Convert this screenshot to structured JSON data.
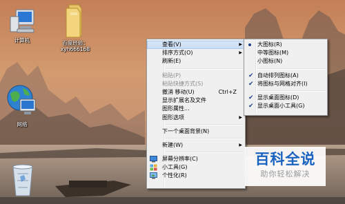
{
  "desktop": {
    "icons": [
      {
        "label": "计算机",
        "icon": "computer-icon"
      },
      {
        "label": "百度经验：",
        "label2": "xyh666168",
        "icon": "folder-icon"
      },
      {
        "label": "网络",
        "icon": "network-icon"
      },
      {
        "label": "",
        "icon": "recycle-bin-icon"
      }
    ]
  },
  "context_menu": {
    "items": [
      {
        "label": "查看(V)",
        "submenu": true,
        "highlighted": true
      },
      {
        "label": "排序方式(O)",
        "submenu": true
      },
      {
        "label": "刷新(E)"
      },
      {
        "label": "粘贴(P)",
        "disabled": true
      },
      {
        "label": "粘贴快捷方式(S)",
        "disabled": true
      },
      {
        "label": "撤消 移动(U)",
        "shortcut": "Ctrl+Z"
      },
      {
        "label": "显示扩展名及文件"
      },
      {
        "label": "图形属性..."
      },
      {
        "label": "图形选项",
        "submenu": true
      },
      {
        "label": "下一个桌面背景(N)"
      },
      {
        "label": "新建(W)",
        "submenu": true
      },
      {
        "label": "屏幕分辨率(C)",
        "icon": "display-settings-icon"
      },
      {
        "label": "小工具(G)",
        "icon": "gadgets-icon"
      },
      {
        "label": "个性化(R)",
        "icon": "personalize-icon"
      }
    ]
  },
  "view_submenu": {
    "items": [
      {
        "label": "大图标(R)",
        "selected": true
      },
      {
        "label": "中等图标(M)"
      },
      {
        "label": "小图标(N)"
      },
      {
        "label": "自动排列图标(A)",
        "checked": true
      },
      {
        "label": "将图标与网格对齐(I)",
        "checked": true
      },
      {
        "label": "显示桌面图标(D)",
        "checked": true
      },
      {
        "label": "显示桌面小工具(G)",
        "checked": true
      }
    ]
  },
  "watermark": {
    "title": "百科全说",
    "subtitle": "助你轻松解决"
  },
  "colors": {
    "menu_bg": "#f0f0f0",
    "highlight": "#cde0f7",
    "check": "#1f3f8a",
    "watermark_text": "#1a62bf"
  }
}
